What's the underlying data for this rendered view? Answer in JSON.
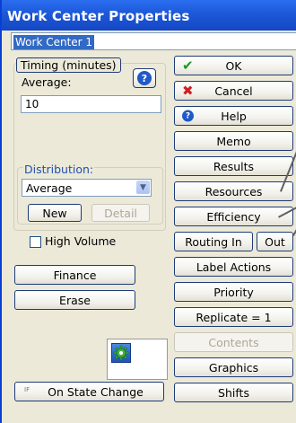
{
  "window": {
    "title": "Work Center Properties"
  },
  "name_field": {
    "value": "Work Center 1"
  },
  "timing": {
    "group_label": "Timing (minutes)",
    "average_label": "Average:",
    "average_value": "10",
    "distribution_label": "Distribution:",
    "distribution_value": "Average",
    "new_label": "New",
    "detail_label": "Detail"
  },
  "high_volume": {
    "label": "High Volume",
    "checked": false
  },
  "left_buttons": {
    "finance": "Finance",
    "erase": "Erase",
    "on_state_change": "On State Change",
    "on_state_prefix": "IF"
  },
  "right_buttons": {
    "ok": "OK",
    "cancel": "Cancel",
    "help": "Help",
    "memo": "Memo",
    "results": "Results",
    "resources": "Resources",
    "efficiency": "Efficiency",
    "routing_in": "Routing In",
    "out": "Out",
    "label_actions": "Label Actions",
    "priority": "Priority",
    "replicate": "Replicate = 1",
    "contents": "Contents",
    "graphics": "Graphics",
    "shifts": "Shifts"
  },
  "colors": {
    "titlebar": "#1c58d8",
    "selection": "#316ac5",
    "ok_check": "#1a9a1a",
    "cancel_x": "#d02020"
  }
}
